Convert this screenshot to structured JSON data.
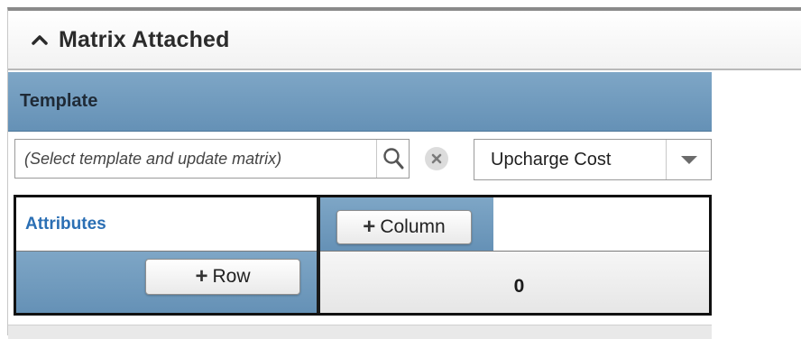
{
  "panel": {
    "title": "Matrix Attached",
    "collapse_icon": "chevron-up-icon"
  },
  "template": {
    "label": "Template",
    "input_value": "(Select template and update matrix)",
    "search_icon": "search-icon",
    "clear_icon": "clear-icon",
    "cost_select": {
      "selected": "Upcharge Cost",
      "arrow_icon": "caret-down-icon"
    }
  },
  "matrix": {
    "attributes_label": "Attributes",
    "add_column_label": "Column",
    "add_row_label": "Row",
    "plus_symbol": "+",
    "cell_value": "0"
  },
  "colors": {
    "header_blue": "#7ea6c6",
    "link_blue": "#2b6fb4"
  }
}
